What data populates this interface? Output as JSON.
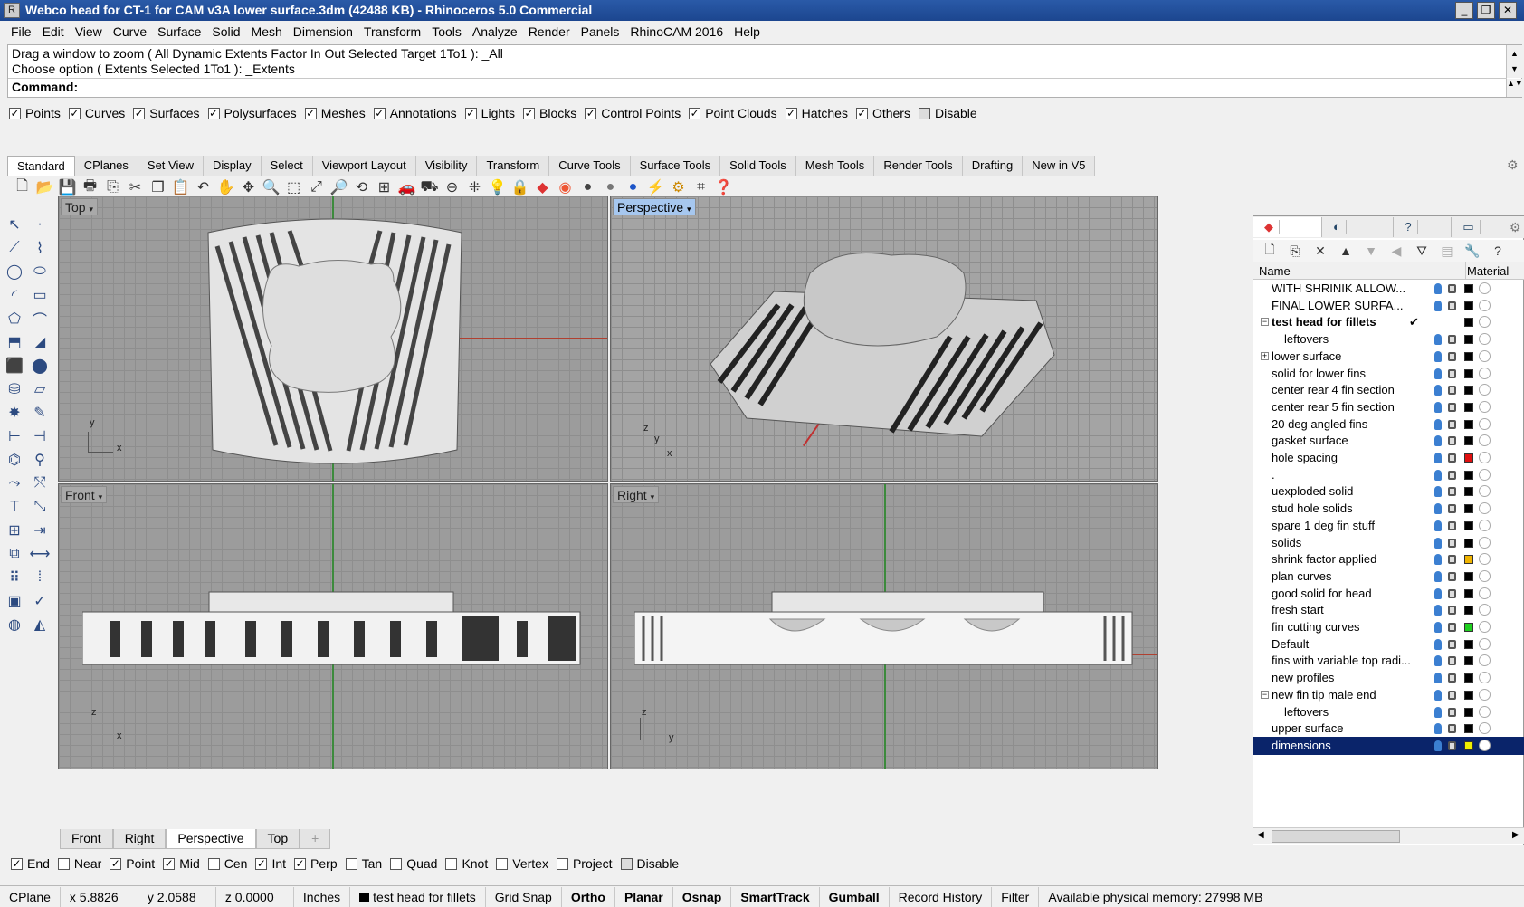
{
  "window": {
    "title": "Webco head for CT-1 for CAM v3A lower surface.3dm (42488 KB) - Rhinoceros 5.0 Commercial",
    "min": "_",
    "max": "❐",
    "close": "✕"
  },
  "menu": [
    "File",
    "Edit",
    "View",
    "Curve",
    "Surface",
    "Solid",
    "Mesh",
    "Dimension",
    "Transform",
    "Tools",
    "Analyze",
    "Render",
    "Panels",
    "RhinoCAM 2016",
    "Help"
  ],
  "command": {
    "line1": "Drag a window to zoom ( All  Dynamic  Extents  Factor  In  Out  Selected  Target  1To1 ): _All",
    "line2": "Choose option ( Extents  Selected  1To1 ): _Extents",
    "prompt": "Command:"
  },
  "select_filter": [
    {
      "label": "Points",
      "checked": true
    },
    {
      "label": "Curves",
      "checked": true
    },
    {
      "label": "Surfaces",
      "checked": true
    },
    {
      "label": "Polysurfaces",
      "checked": true
    },
    {
      "label": "Meshes",
      "checked": true
    },
    {
      "label": "Annotations",
      "checked": true
    },
    {
      "label": "Lights",
      "checked": true
    },
    {
      "label": "Blocks",
      "checked": true
    },
    {
      "label": "Control Points",
      "checked": true
    },
    {
      "label": "Point Clouds",
      "checked": true
    },
    {
      "label": "Hatches",
      "checked": true
    },
    {
      "label": "Others",
      "checked": true
    },
    {
      "label": "Disable",
      "checked": false
    }
  ],
  "toolbar_tabs": [
    "Standard",
    "CPlanes",
    "Set View",
    "Display",
    "Select",
    "Viewport Layout",
    "Visibility",
    "Transform",
    "Curve Tools",
    "Surface Tools",
    "Solid Tools",
    "Mesh Tools",
    "Render Tools",
    "Drafting",
    "New in V5"
  ],
  "active_toolbar_tab": "Standard",
  "viewports": {
    "top": {
      "label": "Top",
      "axes": [
        "y",
        "x"
      ]
    },
    "perspective": {
      "label": "Perspective",
      "axes": [
        "z",
        "y",
        "x"
      ]
    },
    "front": {
      "label": "Front",
      "axes": [
        "z",
        "x"
      ]
    },
    "right": {
      "label": "Right",
      "axes": [
        "z",
        "y"
      ]
    }
  },
  "viewport_tabs": [
    "Front",
    "Right",
    "Perspective",
    "Top",
    "+"
  ],
  "active_viewport_tab": "Perspective",
  "osnap": [
    {
      "label": "End",
      "checked": true
    },
    {
      "label": "Near",
      "checked": false
    },
    {
      "label": "Point",
      "checked": true
    },
    {
      "label": "Mid",
      "checked": true
    },
    {
      "label": "Cen",
      "checked": false
    },
    {
      "label": "Int",
      "checked": true
    },
    {
      "label": "Perp",
      "checked": true
    },
    {
      "label": "Tan",
      "checked": false
    },
    {
      "label": "Quad",
      "checked": false
    },
    {
      "label": "Knot",
      "checked": false
    },
    {
      "label": "Vertex",
      "checked": false
    },
    {
      "label": "Project",
      "checked": false
    },
    {
      "label": "Disable",
      "checked": false
    }
  ],
  "status": {
    "cplane": "CPlane",
    "x": "x 5.8826",
    "y": "y 2.0588",
    "z": "z 0.0000",
    "units": "Inches",
    "layer": "test head for fillets",
    "grid_snap": "Grid Snap",
    "ortho": "Ortho",
    "planar": "Planar",
    "osnap": "Osnap",
    "smarttrack": "SmartTrack",
    "gumball": "Gumball",
    "record_history": "Record History",
    "filter": "Filter",
    "memory": "Available physical memory: 27998 MB"
  },
  "panel": {
    "tabs": [
      "Layers",
      "Prope...",
      "Help",
      "Display"
    ],
    "columns": {
      "name": "Name",
      "material": "Material"
    },
    "layers": [
      {
        "name": "WITH SHRINIK ALLOW...",
        "indent": 0,
        "color": "#000000"
      },
      {
        "name": "FINAL LOWER SURFA...",
        "indent": 0,
        "color": "#000000"
      },
      {
        "name": "test head for fillets",
        "indent": 0,
        "current": true,
        "expanded": "minus",
        "color": "#000000",
        "check": "✔"
      },
      {
        "name": "leftovers",
        "indent": 1,
        "color": "#000000"
      },
      {
        "name": "lower surface",
        "indent": 0,
        "expanded": "plus",
        "color": "#000000"
      },
      {
        "name": "solid for lower fins",
        "indent": 0,
        "color": "#000000"
      },
      {
        "name": "center rear 4 fin section",
        "indent": 0,
        "color": "#000000"
      },
      {
        "name": "center rear 5 fin section",
        "indent": 0,
        "color": "#000000"
      },
      {
        "name": "20 deg angled fins",
        "indent": 0,
        "color": "#000000"
      },
      {
        "name": "gasket surface",
        "indent": 0,
        "color": "#000000"
      },
      {
        "name": "hole spacing",
        "indent": 0,
        "color": "#e01010"
      },
      {
        "name": ".",
        "indent": 0,
        "color": "#000000"
      },
      {
        "name": "uexploded solid",
        "indent": 0,
        "color": "#000000"
      },
      {
        "name": "stud hole solids",
        "indent": 0,
        "color": "#000000"
      },
      {
        "name": "spare 1 deg fin stuff",
        "indent": 0,
        "color": "#000000"
      },
      {
        "name": "solids",
        "indent": 0,
        "color": "#000000"
      },
      {
        "name": "shrink factor applied",
        "indent": 0,
        "color": "#f0b400"
      },
      {
        "name": "plan curves",
        "indent": 0,
        "color": "#000000"
      },
      {
        "name": "good solid for head",
        "indent": 0,
        "color": "#000000"
      },
      {
        "name": "fresh start",
        "indent": 0,
        "color": "#000000"
      },
      {
        "name": "fin cutting curves",
        "indent": 0,
        "color": "#20d020"
      },
      {
        "name": "Default",
        "indent": 0,
        "color": "#000000"
      },
      {
        "name": "fins with variable top radi...",
        "indent": 0,
        "color": "#000000"
      },
      {
        "name": "new profiles",
        "indent": 0,
        "color": "#000000"
      },
      {
        "name": "new fin tip male end",
        "indent": 0,
        "expanded": "minus",
        "color": "#000000"
      },
      {
        "name": "leftovers",
        "indent": 1,
        "color": "#000000"
      },
      {
        "name": "upper surface",
        "indent": 0,
        "color": "#000000"
      },
      {
        "name": "dimensions",
        "indent": 0,
        "selected": true,
        "color": "#f0f000"
      }
    ]
  }
}
